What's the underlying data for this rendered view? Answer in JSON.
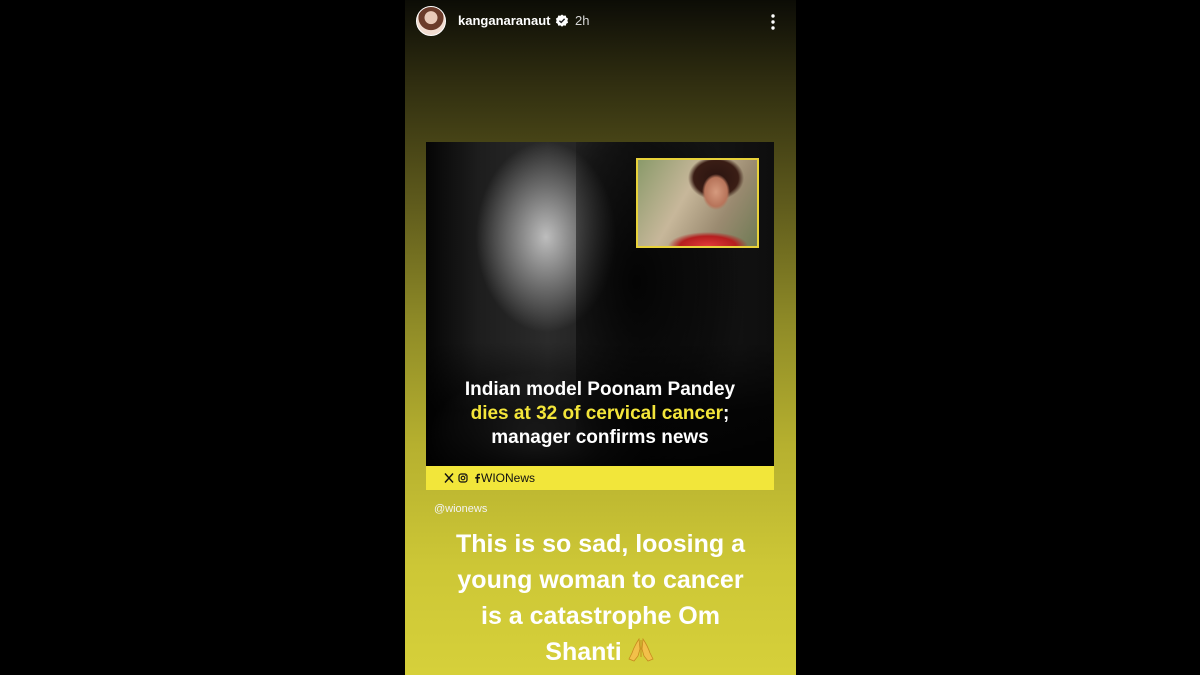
{
  "story": {
    "username": "kanganaranaut",
    "time": "2h",
    "icons": {
      "verified": "verified-badge-icon",
      "more": "more-options-icon"
    }
  },
  "post": {
    "headline": {
      "line1": "Indian model Poonam Pandey",
      "line2_highlight": "dies at 32 of cervical cancer",
      "line2_suffix": ";",
      "line3": "manager confirms news"
    },
    "footer_handle": "WIONews",
    "footer_icons": [
      "x-icon",
      "instagram-icon",
      "facebook-icon"
    ],
    "accent_color": "#f3e53a"
  },
  "mention": "@wionews",
  "caption": {
    "lines": [
      "This is so sad, loosing a",
      "young woman to cancer",
      "is a catastrophe Om",
      "Shanti"
    ],
    "emoji": "🙏"
  }
}
